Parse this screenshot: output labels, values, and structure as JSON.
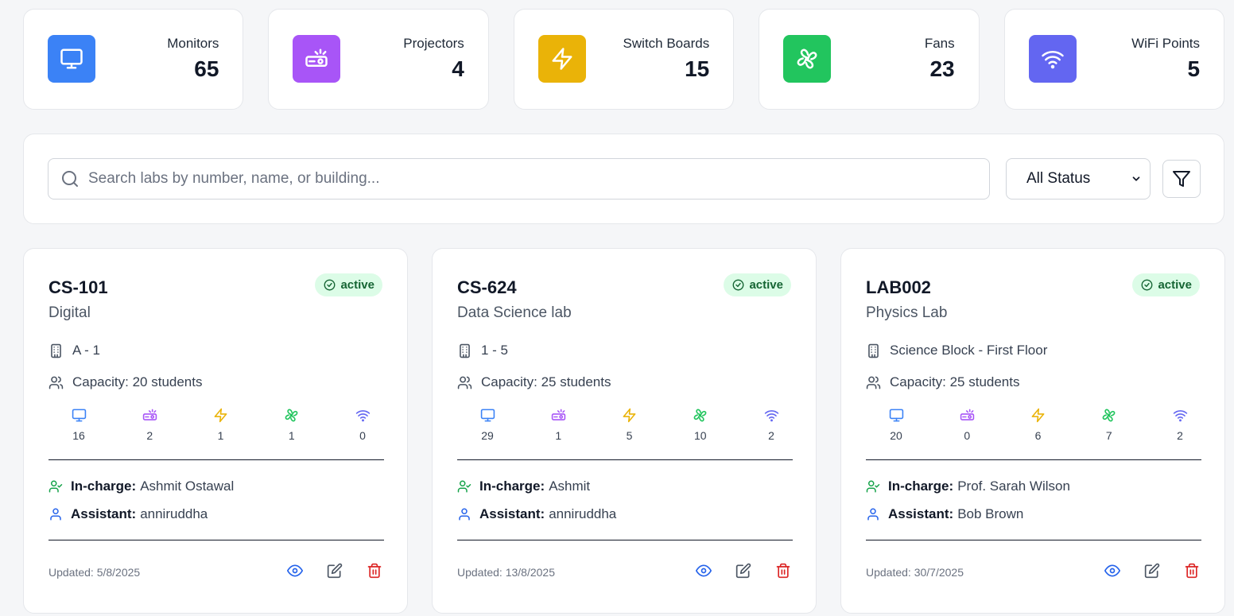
{
  "stats": [
    {
      "label": "Monitors",
      "value": "65",
      "icon": "monitor-icon",
      "color": "#3b82f6"
    },
    {
      "label": "Projectors",
      "value": "4",
      "icon": "projector-icon",
      "color": "#a855f7"
    },
    {
      "label": "Switch Boards",
      "value": "15",
      "icon": "lightning-icon",
      "color": "#eab308"
    },
    {
      "label": "Fans",
      "value": "23",
      "icon": "fan-icon",
      "color": "#22c55e"
    },
    {
      "label": "WiFi Points",
      "value": "5",
      "icon": "wifi-icon",
      "color": "#6366f1"
    }
  ],
  "search": {
    "placeholder": "Search labs by number, name, or building...",
    "status_filter": "All Status"
  },
  "labs": [
    {
      "number": "CS-101",
      "name": "Digital",
      "status": "active",
      "building": "A - 1",
      "capacity": "Capacity: 20 students",
      "equipment": [
        "16",
        "2",
        "1",
        "1",
        "0"
      ],
      "incharge_label": "In-charge:",
      "incharge": "Ashmit Ostawal",
      "assistant_label": "Assistant:",
      "assistant": "anniruddha",
      "updated": "Updated: 5/8/2025"
    },
    {
      "number": "CS-624",
      "name": "Data Science lab",
      "status": "active",
      "building": "1 - 5",
      "capacity": "Capacity: 25 students",
      "equipment": [
        "29",
        "1",
        "5",
        "10",
        "2"
      ],
      "incharge_label": "In-charge:",
      "incharge": "Ashmit",
      "assistant_label": "Assistant:",
      "assistant": "anniruddha",
      "updated": "Updated: 13/8/2025"
    },
    {
      "number": "LAB002",
      "name": "Physics Lab",
      "status": "active",
      "building": "Science Block - First Floor",
      "capacity": "Capacity: 25 students",
      "equipment": [
        "20",
        "0",
        "6",
        "7",
        "2"
      ],
      "incharge_label": "In-charge:",
      "incharge": "Prof. Sarah Wilson",
      "assistant_label": "Assistant:",
      "assistant": "Bob Brown",
      "updated": "Updated: 30/7/2025"
    }
  ]
}
